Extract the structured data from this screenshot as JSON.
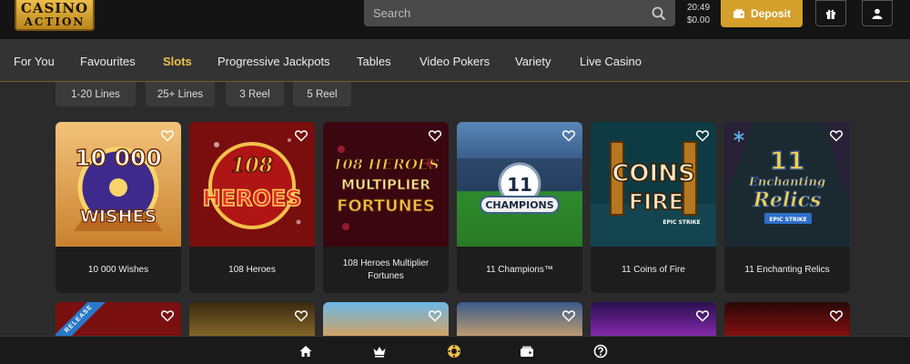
{
  "header": {
    "logo_line1": "CASINO",
    "logo_line2": "ACTION",
    "search_placeholder": "Search",
    "time": "20:49",
    "balance": "$0.00",
    "deposit_label": "Deposit"
  },
  "nav": {
    "items": [
      "For You",
      "Favourites",
      "Slots",
      "Progressive Jackpots",
      "Tables",
      "Video Pokers",
      "Variety",
      "Live Casino"
    ],
    "active": "Slots"
  },
  "filters": [
    "1-20 Lines",
    "25+ Lines",
    "3 Reel",
    "5 Reel"
  ],
  "games": [
    {
      "title": "10 000 Wishes",
      "art_line1": "10 000",
      "art_line2": "WISHES"
    },
    {
      "title": "108 Heroes",
      "art_line1": "108",
      "art_line2": "HEROES"
    },
    {
      "title": "108 Heroes Multiplier Fortunes",
      "art_line1": "108 HEROES",
      "art_line2": "MULTIPLIER",
      "art_line3": "FORTUNES"
    },
    {
      "title": "11 Champions™",
      "art_line1": "11",
      "art_line2": "CHAMPIONS"
    },
    {
      "title": "11 Coins of Fire",
      "art_line1": "COINS",
      "art_line2": "FIRE",
      "art_line3": "EPIC STRIKE"
    },
    {
      "title": "11 Enchanting Relics",
      "art_line1": "11",
      "art_line2": "Enchanting",
      "art_line3": "Relics",
      "art_line4": "EPIC STRIKE"
    }
  ],
  "second_row": {
    "ribbon_label": "RELEASE"
  },
  "colors": {
    "accent": "#f0c04a",
    "deposit": "#d59f2c",
    "background": "#2b2b2b",
    "header": "#141414"
  },
  "icons": {
    "search": "search-icon",
    "gift": "gift-icon",
    "user": "user-icon",
    "heart": "heart-icon",
    "home": "home-icon",
    "crown": "crown-icon",
    "slots": "slots-icon",
    "wallet": "wallet-icon",
    "help": "help-icon"
  }
}
